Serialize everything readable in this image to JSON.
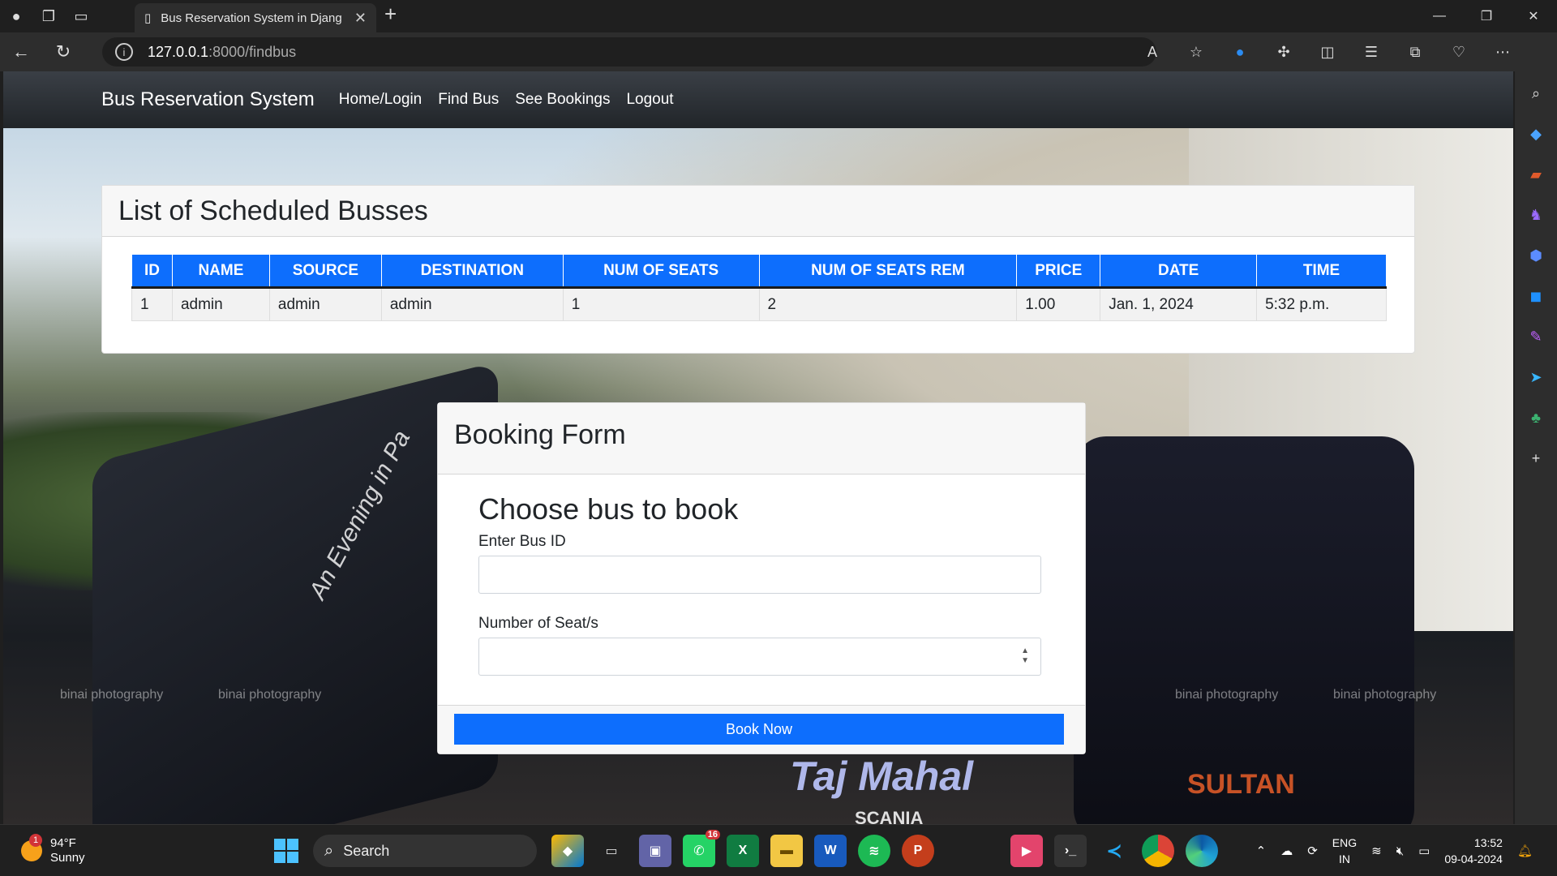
{
  "browser": {
    "tab_title": "Bus Reservation System in Djang",
    "url_host": "127.0.0.1",
    "url_path": ":8000/findbus"
  },
  "navbar": {
    "brand": "Bus Reservation System",
    "links": [
      "Home/Login",
      "Find Bus",
      "See Bookings",
      "Logout"
    ]
  },
  "list": {
    "title": "List of Scheduled Busses",
    "columns": [
      "ID",
      "NAME",
      "SOURCE",
      "DESTINATION",
      "NUM OF SEATS",
      "NUM OF SEATS REM",
      "PRICE",
      "DATE",
      "TIME"
    ],
    "rows": [
      [
        "1",
        "admin",
        "admin",
        "admin",
        "1",
        "2",
        "1.00",
        "Jan. 1, 2024",
        "5:32 p.m."
      ]
    ]
  },
  "form": {
    "header": "Booking Form",
    "title": "Choose bus to book",
    "bus_id_label": "Enter Bus ID",
    "seats_label": "Number of Seat/s",
    "submit_label": "Book Now"
  },
  "background": {
    "watermarks": [
      "binai photography",
      "binai photography",
      "binai photography",
      "binai photography"
    ],
    "bus_texts": [
      "An Evening in Pa",
      "Taj Mahal",
      "SULTAN",
      "SCANIA"
    ]
  },
  "taskbar": {
    "weather_temp": "94°F",
    "weather_desc": "Sunny",
    "weather_badge": "1",
    "search_label": "Search",
    "whatsapp_badge": "16",
    "lang_top": "ENG",
    "lang_bottom": "IN",
    "time": "13:52",
    "date": "09-04-2024"
  },
  "colors": {
    "primary": "#0d6efd",
    "navbar": "#212529"
  }
}
